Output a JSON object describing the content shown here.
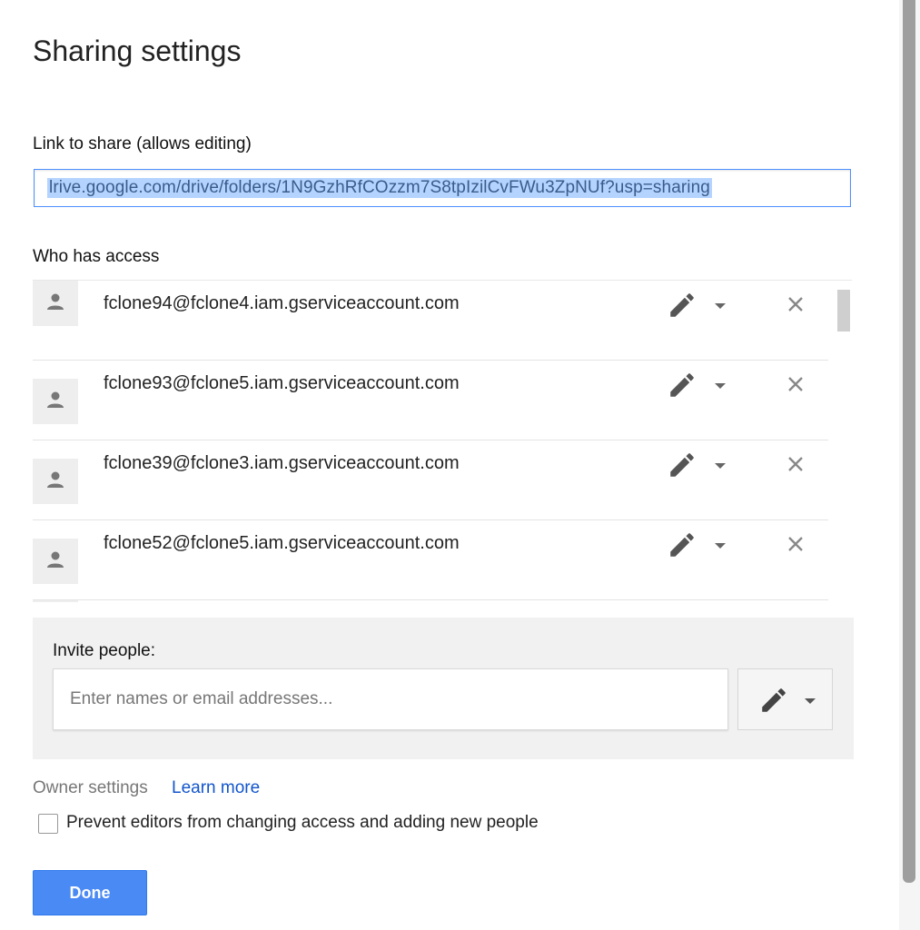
{
  "dialog": {
    "title": "Sharing settings"
  },
  "link_section": {
    "label": "Link to share (allows editing)",
    "url": "lrive.google.com/drive/folders/1N9GzhRfCOzzm7S8tpIzilCvFWu3ZpNUf?usp=sharing"
  },
  "access": {
    "label": "Who has access",
    "people": [
      {
        "email": "fclone94@fclone4.iam.gserviceaccount.com",
        "permission_icon": "pencil-icon"
      },
      {
        "email": "fclone93@fclone5.iam.gserviceaccount.com",
        "permission_icon": "pencil-icon"
      },
      {
        "email": "fclone39@fclone3.iam.gserviceaccount.com",
        "permission_icon": "pencil-icon"
      },
      {
        "email": "fclone52@fclone5.iam.gserviceaccount.com",
        "permission_icon": "pencil-icon"
      }
    ]
  },
  "invite": {
    "label": "Invite people:",
    "placeholder": "Enter names or email addresses..."
  },
  "owner_settings": {
    "label": "Owner settings",
    "learn_more": "Learn more",
    "prevent_editors_label": "Prevent editors from changing access and adding new people",
    "prevent_editors_checked": false
  },
  "actions": {
    "done_label": "Done"
  },
  "colors": {
    "accent": "#4a8af4",
    "link": "#1155cc",
    "selection": "#b4d4ff"
  }
}
